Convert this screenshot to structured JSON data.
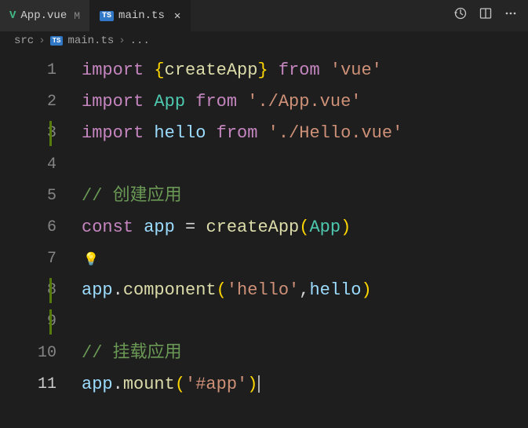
{
  "tabs": [
    {
      "icon": "V",
      "label": "App.vue",
      "modified": "M",
      "active": false
    },
    {
      "icon": "TS",
      "label": "main.ts",
      "modified": "",
      "active": true
    }
  ],
  "breadcrumb": {
    "parts": [
      "src",
      "main.ts",
      "..."
    ]
  },
  "code": {
    "lines": [
      {
        "n": "1",
        "tokens": [
          [
            "kw",
            "import"
          ],
          [
            "pun",
            " "
          ],
          [
            "brk",
            "{"
          ],
          [
            "fn",
            "createApp"
          ],
          [
            "brk",
            "}"
          ],
          [
            "pun",
            " "
          ],
          [
            "kw",
            "from"
          ],
          [
            "pun",
            " "
          ],
          [
            "str",
            "'vue'"
          ]
        ]
      },
      {
        "n": "2",
        "tokens": [
          [
            "kw",
            "import"
          ],
          [
            "pun",
            " "
          ],
          [
            "cls",
            "App"
          ],
          [
            "pun",
            " "
          ],
          [
            "kw",
            "from"
          ],
          [
            "pun",
            " "
          ],
          [
            "str",
            "'./App.vue'"
          ]
        ]
      },
      {
        "n": "3",
        "mod": true,
        "tokens": [
          [
            "kw",
            "import"
          ],
          [
            "pun",
            " "
          ],
          [
            "var",
            "hello"
          ],
          [
            "pun",
            " "
          ],
          [
            "kw",
            "from"
          ],
          [
            "pun",
            " "
          ],
          [
            "str",
            "'./Hello.vue'"
          ]
        ]
      },
      {
        "n": "4",
        "tokens": []
      },
      {
        "n": "5",
        "tokens": [
          [
            "com",
            "// 创建应用"
          ]
        ]
      },
      {
        "n": "6",
        "tokens": [
          [
            "kw",
            "const"
          ],
          [
            "pun",
            " "
          ],
          [
            "var",
            "app"
          ],
          [
            "pun",
            " "
          ],
          [
            "pun",
            "="
          ],
          [
            "pun",
            " "
          ],
          [
            "fn",
            "createApp"
          ],
          [
            "brk",
            "("
          ],
          [
            "cls",
            "App"
          ],
          [
            "brk",
            ")"
          ]
        ]
      },
      {
        "n": "7",
        "bulb": true,
        "tokens": []
      },
      {
        "n": "8",
        "mod": true,
        "tokens": [
          [
            "var",
            "app"
          ],
          [
            "pun",
            "."
          ],
          [
            "fn",
            "component"
          ],
          [
            "brk",
            "("
          ],
          [
            "str",
            "'hello'"
          ],
          [
            "pun",
            ","
          ],
          [
            "var",
            "hello"
          ],
          [
            "brk",
            ")"
          ]
        ]
      },
      {
        "n": "9",
        "mod": true,
        "tokens": []
      },
      {
        "n": "10",
        "tokens": [
          [
            "com",
            "// 挂载应用"
          ]
        ]
      },
      {
        "n": "11",
        "current": true,
        "tokens": [
          [
            "var",
            "app"
          ],
          [
            "pun",
            "."
          ],
          [
            "fn",
            "mount"
          ],
          [
            "brk",
            "("
          ],
          [
            "str",
            "'#app'"
          ],
          [
            "brk",
            ")"
          ]
        ]
      }
    ]
  },
  "icons": {
    "bulb": "💡"
  }
}
